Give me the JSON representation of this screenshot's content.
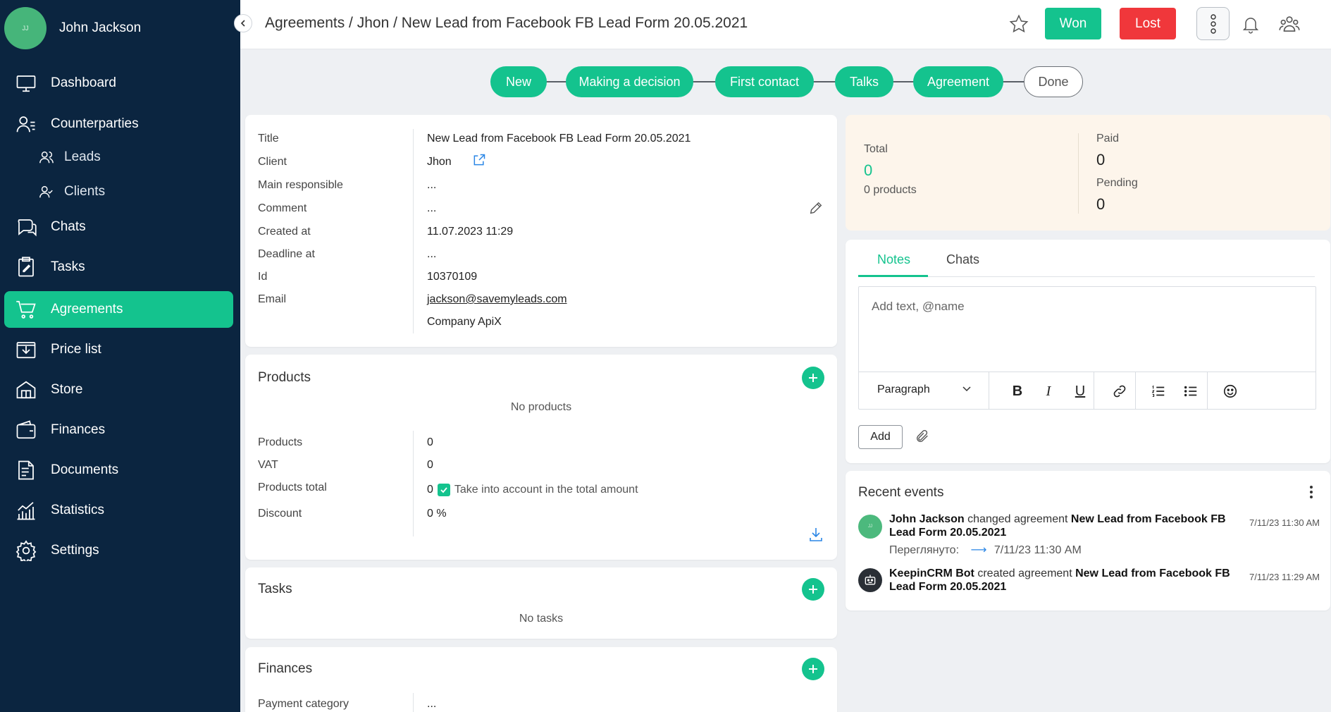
{
  "user": {
    "name": "John Jackson",
    "initials": "JJ"
  },
  "sidebar": {
    "items": [
      {
        "label": "Dashboard",
        "icon": "monitor-icon"
      },
      {
        "label": "Counterparties",
        "icon": "contacts-icon"
      },
      {
        "label": "Leads",
        "icon": "users-icon"
      },
      {
        "label": "Clients",
        "icon": "user-check-icon"
      },
      {
        "label": "Chats",
        "icon": "chat-icon"
      },
      {
        "label": "Tasks",
        "icon": "clipboard-icon"
      },
      {
        "label": "Agreements",
        "icon": "cart-icon"
      },
      {
        "label": "Price list",
        "icon": "download-box-icon"
      },
      {
        "label": "Store",
        "icon": "store-icon"
      },
      {
        "label": "Finances",
        "icon": "wallet-icon"
      },
      {
        "label": "Documents",
        "icon": "document-icon"
      },
      {
        "label": "Statistics",
        "icon": "chart-icon"
      },
      {
        "label": "Settings",
        "icon": "gear-icon"
      }
    ]
  },
  "header": {
    "breadcrumb": "Agreements / Jhon / New Lead from Facebook FB Lead Form 20.05.2021",
    "won": "Won",
    "lost": "Lost"
  },
  "pipeline": [
    "New",
    "Making a decision",
    "First contact",
    "Talks",
    "Agreement",
    "Done"
  ],
  "details": {
    "rows": [
      {
        "label": "Title",
        "value": "New Lead from Facebook FB Lead Form 20.05.2021"
      },
      {
        "label": "Client",
        "value": "Jhon"
      },
      {
        "label": "Main responsible",
        "value": "..."
      },
      {
        "label": "Comment",
        "value": "..."
      },
      {
        "label": "Created at",
        "value": "11.07.2023 11:29"
      },
      {
        "label": "Deadline at",
        "value": "..."
      },
      {
        "label": "Id",
        "value": "10370109"
      },
      {
        "label": "Email",
        "value": "jackson@savemyleads.com"
      }
    ],
    "company": "Company ApiX"
  },
  "products": {
    "title": "Products",
    "empty": "No products",
    "rows": [
      {
        "label": "Products",
        "value": "0"
      },
      {
        "label": "VAT",
        "value": "0"
      },
      {
        "label": "Products total",
        "value": "0"
      },
      {
        "label": "Discount",
        "value": "0 %"
      }
    ],
    "take_into_account": "Take into account in the total amount"
  },
  "tasks": {
    "title": "Tasks",
    "empty": "No tasks"
  },
  "finances": {
    "title": "Finances",
    "payment_category_label": "Payment category",
    "payment_category_value": "..."
  },
  "summary": {
    "total_label": "Total",
    "total_value": "0",
    "products_count": "0 products",
    "paid_label": "Paid",
    "paid_value": "0",
    "pending_label": "Pending",
    "pending_value": "0"
  },
  "notes": {
    "tabs": [
      "Notes",
      "Chats"
    ],
    "placeholder": "Add text, @name",
    "paragraph": "Paragraph",
    "add": "Add"
  },
  "events": {
    "title": "Recent events",
    "items": [
      {
        "actor": "John Jackson",
        "action": " changed agreement ",
        "target": "New Lead from Facebook FB Lead Form 20.05.2021",
        "viewed_label": "Переглянуто:",
        "viewed_time": "7/11/23 11:30 AM",
        "time": "7/11/23 11:30 AM"
      },
      {
        "actor": "KeepinCRM Bot",
        "action": " created agreement ",
        "target": "New Lead from Facebook FB Lead Form 20.05.2021",
        "time": "7/11/23 11:29 AM"
      }
    ]
  },
  "colors": {
    "accent": "#14c38e",
    "danger": "#f0373b",
    "sidebar": "#0b2540"
  }
}
